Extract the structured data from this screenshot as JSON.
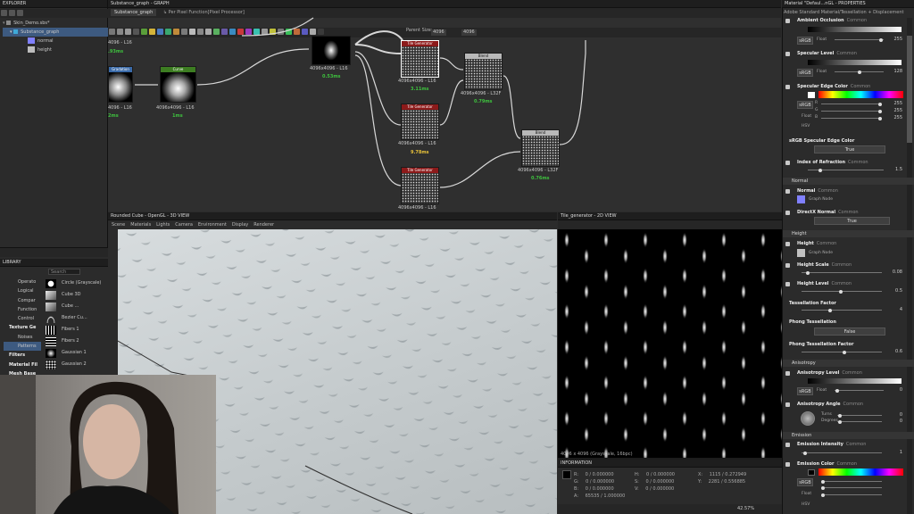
{
  "explorer": {
    "title": "EXPLORER",
    "package": "Skin_Demo.sbs*",
    "graph": "Substance_graph",
    "outputs": [
      "normal",
      "height"
    ]
  },
  "graph_panel": {
    "title": "Substance_graph - GRAPH",
    "tab": "Substance_graph",
    "breadcrumb": "↳ Per Pixel Function[Pixel Processor]",
    "parent_size_label": "Parent Size:",
    "parent_size_a": "4096",
    "parent_size_b": "4096"
  },
  "nodes": [
    {
      "name": "Tile Generator",
      "label": "4096x4096 - L16",
      "time": "3.11ms"
    },
    {
      "name": "Tile Generator",
      "label": "4096x4096 - L16",
      "time": "9.78ms"
    },
    {
      "name": "Tile Generator",
      "label": "4096x4096 - L16",
      "time": ""
    },
    {
      "name": "Blend",
      "label": "4096x4096 - L32F",
      "time": "0.79ms"
    },
    {
      "name": "Blend",
      "label": "4096x4096 - L32F",
      "time": "0.76ms"
    },
    {
      "name": "Curve",
      "label": "4096x4096 - L16",
      "time": "1ms"
    },
    {
      "name": "Gradation (B)",
      "label": "4096 - L16",
      "time": "2ms"
    },
    {
      "name": "",
      "label": "4096x4096 - L16",
      "time": "0.53ms"
    },
    {
      "name": "",
      "label": "4096 - L16",
      "time": ".93ms"
    }
  ],
  "view3d": {
    "title": "Rounded Cube - OpenGL - 3D VIEW",
    "menu": [
      "Scene",
      "Materials",
      "Lights",
      "Camera",
      "Environment",
      "Display",
      "Renderer"
    ]
  },
  "view2d": {
    "title": "Tile_generator - 2D VIEW",
    "status": "4096 x 4096 (Grayscale, 16bpc)",
    "zoom": "42.57%"
  },
  "information": {
    "title": "INFORMATION",
    "col1": [
      [
        "R:",
        "0 / 0.000000"
      ],
      [
        "G:",
        "0 / 0.000000"
      ],
      [
        "B:",
        "0 / 0.000000"
      ],
      [
        "A:",
        "65535 / 1.000000"
      ]
    ],
    "col2": [
      [
        "H:",
        "0 / 0.000000"
      ],
      [
        "S:",
        "0 / 0.000000"
      ],
      [
        "V:",
        "0 / 0.000000"
      ]
    ],
    "col3": [
      [
        "X:",
        "1115 / 0.272949"
      ],
      [
        "Y:",
        "2281 / 0.556885"
      ]
    ]
  },
  "library": {
    "title": "LIBRARY",
    "search_placeholder": "Search",
    "categories": [
      "Operato",
      "Logical",
      "Compar",
      "Function",
      "Control",
      "Texture Ge",
      "Noises",
      "Patterns",
      "Filters",
      "Material Fil",
      "Mesh Base"
    ],
    "items": [
      "Circle (Grayscale)",
      "Cube 3D",
      "Cube ...",
      "Bezier Cu...",
      "Fibers 1",
      "Fibers 2",
      "Gaussian 1",
      "Gaussian 2"
    ]
  },
  "properties": {
    "title": "Material \"Defaul...nGL - PROPERTIES",
    "subtitle": "Adobe Standard Material/Tessellation + Displacement",
    "sections": {
      "normal": "Normal",
      "height": "Height",
      "anisotropy": "Anisotropy",
      "emission": "Emission"
    },
    "ambient_occlusion": {
      "label": "Ambient Occlusion",
      "tag": "Common",
      "val1": "255",
      "val2": "255"
    },
    "specular_level": {
      "label": "Specular Level",
      "tag": "Common",
      "val1": "255",
      "val2": "128"
    },
    "specular_edge_color": {
      "label": "Specular Edge Color",
      "tag": "Common",
      "r": "255",
      "g": "255",
      "b": "255"
    },
    "srgb_specular_edge": {
      "label": "sRGB Specular Edge Color",
      "button": "True"
    },
    "ior": {
      "label": "Index of Refraction",
      "tag": "Common",
      "value": "1.5"
    },
    "normal": {
      "label": "Normal",
      "tag": "Common",
      "node": "Graph Node"
    },
    "directx_normal": {
      "label": "DirectX Normal",
      "tag": "Common",
      "button": "True"
    },
    "height": {
      "label": "Height",
      "tag": "Common",
      "node": "Graph Node"
    },
    "height_scale": {
      "label": "Height Scale",
      "tag": "Common",
      "value": "0.08"
    },
    "height_level": {
      "label": "Height Level",
      "tag": "Common",
      "value": "0.5"
    },
    "tess_factor": {
      "label": "Tessellation Factor",
      "value": "4"
    },
    "phong_tess": {
      "label": "Phong Tessellation",
      "button": "False"
    },
    "phong_factor": {
      "label": "Phong Tessellation Factor",
      "value": "0.6"
    },
    "aniso_level": {
      "label": "Anisotropy Level",
      "tag": "Common",
      "value": "0"
    },
    "aniso_angle": {
      "label": "Anisotropy Angle",
      "tag": "Common",
      "turns_label": "Turns",
      "degrees_label": "Degrees",
      "turns": "0",
      "degrees": "0"
    },
    "emission_intensity": {
      "label": "Emission Intensity",
      "tag": "Common",
      "value": "1"
    },
    "emission_color": {
      "label": "Emission Color",
      "tag": "Common"
    },
    "srgb": "sRGB",
    "float": "Float",
    "hsv": "HSV",
    "r": "R",
    "g": "G",
    "b": "B"
  },
  "colors": {
    "tile_header": "#8c1a1a",
    "blend_header": "#b9b9b9",
    "curve_header": "#3d7d22",
    "time_green": "#3ec13e",
    "time_yellow": "#e8c23a",
    "selected_border": "#ffffff"
  }
}
